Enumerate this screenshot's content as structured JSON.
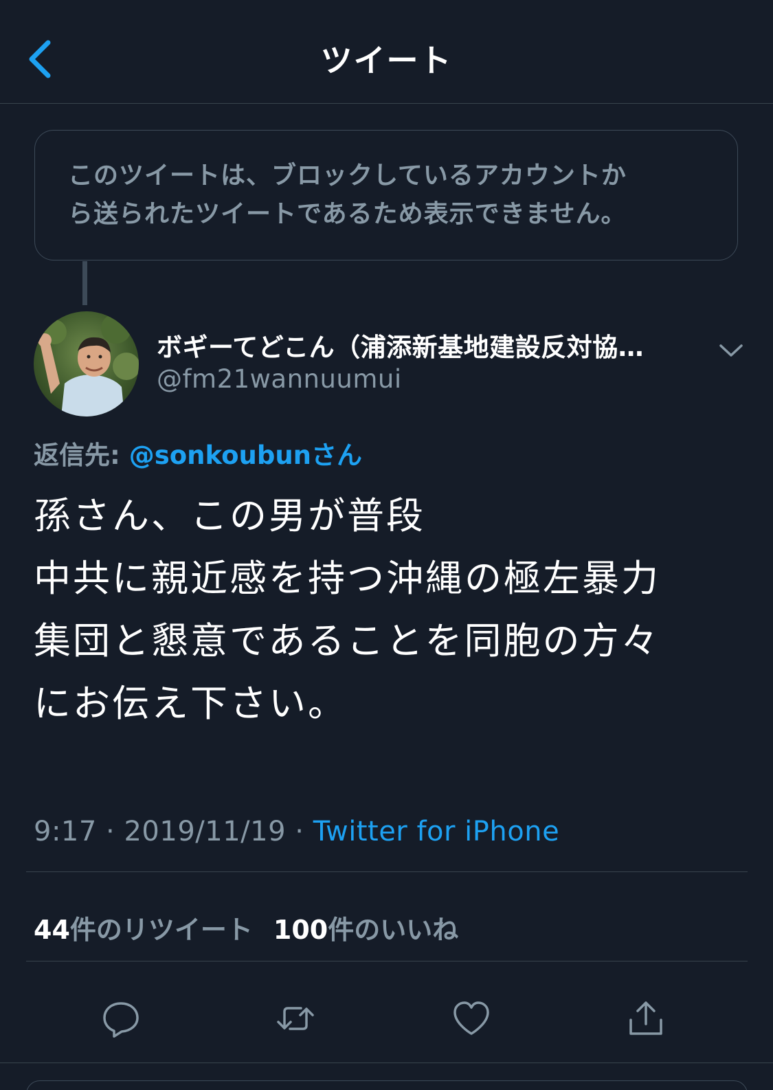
{
  "nav": {
    "title": "ツイート",
    "back_icon": "chevron-left-icon"
  },
  "blocked_notice": {
    "line1": "このツイートは、ブロックしているアカウントか",
    "line2": "ら送られたツイートであるため表示できません。"
  },
  "author": {
    "display_name": "ボギーてどこん（浦添新基地建設反対協…",
    "handle": "@fm21wannuumui",
    "avatar": "avatar"
  },
  "reply_to": {
    "prefix": "返信先: ",
    "mention": "@sonkoubunさん"
  },
  "tweet": {
    "lines": [
      "孫さん、この男が普段",
      "中共に親近感を持つ沖縄の極左暴力",
      "集団と懇意であることを同胞の方々",
      "にお伝え下さい。"
    ]
  },
  "meta": {
    "time": "9:17",
    "separator": " · ",
    "date": "2019/11/19",
    "source": "Twitter for iPhone"
  },
  "stats": {
    "retweets_count": "44",
    "retweets_label": "件のリツイート",
    "likes_count": "100",
    "likes_label": "件のいいね"
  },
  "actions": [
    "reply-icon",
    "retweet-icon",
    "like-icon",
    "share-icon"
  ],
  "colors": {
    "background": "#151c28",
    "accent": "#1da1f2",
    "secondary_text": "#8899a6",
    "divider": "#38444d"
  }
}
